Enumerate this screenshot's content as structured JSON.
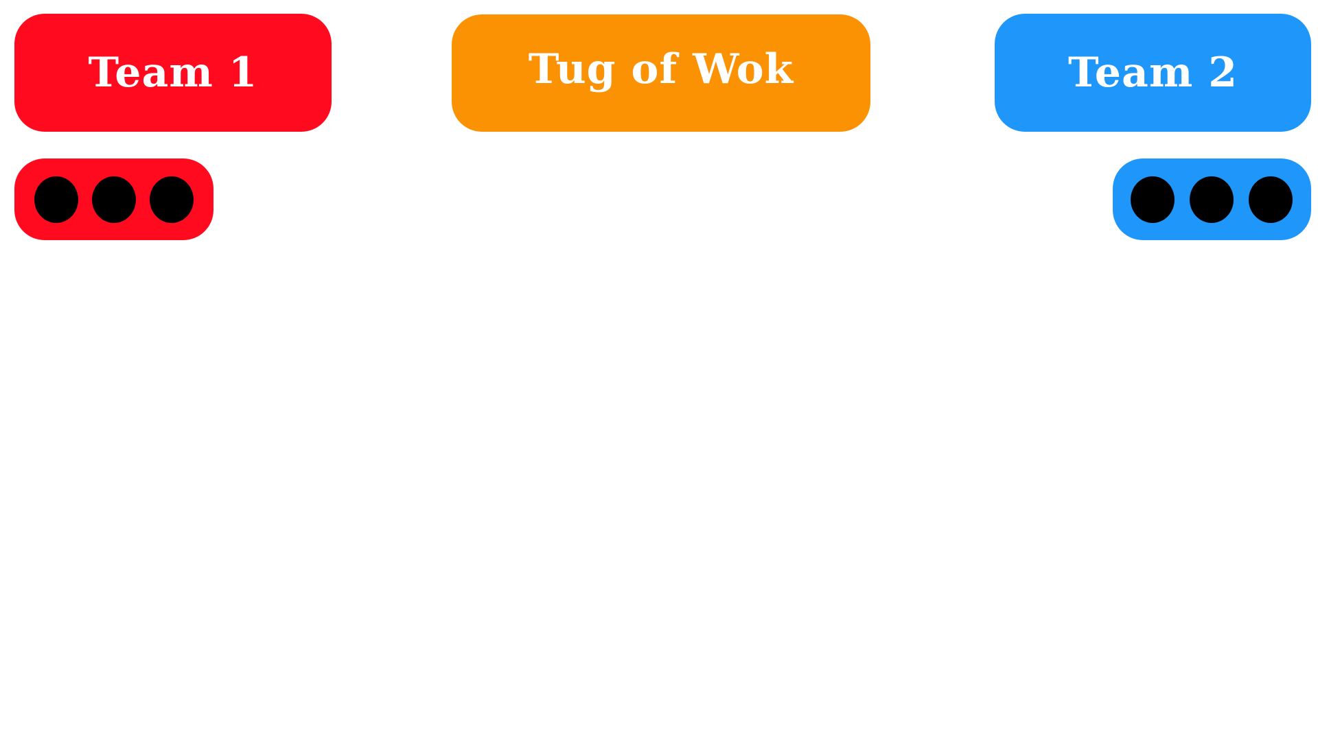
{
  "colors": {
    "team1": "#ff0a1e",
    "title": "#fa9204",
    "team2": "#1e96fa",
    "life": "#000000",
    "text": "#ffffff"
  },
  "header": {
    "team1_label": "Team 1",
    "title": "Tug of Wok",
    "team2_label": "Team 2"
  },
  "lives": {
    "team1": {
      "remaining": 3,
      "icon": "life-dot-icon"
    },
    "team2": {
      "remaining": 3,
      "icon": "life-dot-icon"
    }
  }
}
